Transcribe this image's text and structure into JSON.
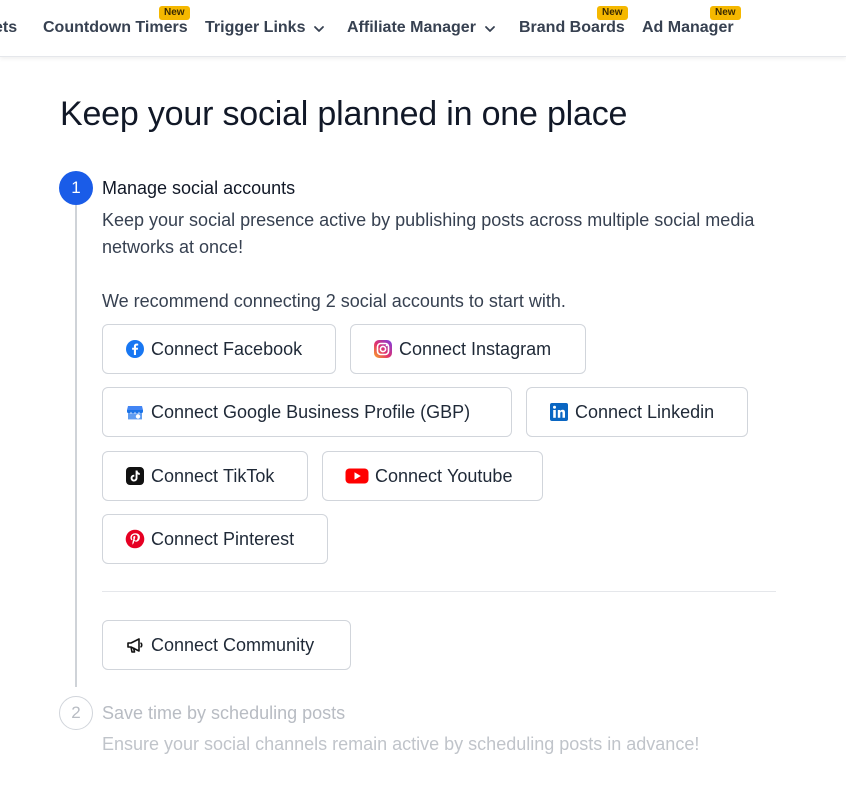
{
  "nav": {
    "items": [
      {
        "label": "ets"
      },
      {
        "label": "Countdown Timers",
        "badge": "New"
      },
      {
        "label": "Trigger Links"
      },
      {
        "label": "Affiliate Manager"
      },
      {
        "label": "Brand Boards",
        "badge": "New"
      },
      {
        "label": "Ad Manager",
        "badge": "New"
      }
    ]
  },
  "page": {
    "title": "Keep your social planned in one place"
  },
  "steps": [
    {
      "number": "1",
      "title": "Manage social accounts",
      "description": "Keep your social presence active by publishing posts across multiple social media networks at once!",
      "recommend": "We recommend connecting 2 social accounts to start with.",
      "connect_word": "Connect",
      "accounts": [
        {
          "name": "Facebook",
          "icon": "facebook-icon"
        },
        {
          "name": "Instagram",
          "icon": "instagram-icon"
        },
        {
          "name": "Google Business Profile (GBP)",
          "icon": "google-business-icon"
        },
        {
          "name": "Linkedin",
          "icon": "linkedin-icon"
        },
        {
          "name": "TikTok",
          "icon": "tiktok-icon"
        },
        {
          "name": "Youtube",
          "icon": "youtube-icon"
        },
        {
          "name": "Pinterest",
          "icon": "pinterest-icon"
        },
        {
          "name": "Community",
          "icon": "megaphone-icon"
        }
      ]
    },
    {
      "number": "2",
      "title": "Save time by scheduling posts",
      "description": "Ensure your social channels remain active by scheduling posts in advance!"
    }
  ],
  "colors": {
    "accent": "#1a5ce8",
    "badge": "#f5b800",
    "facebook": "#1877f2",
    "linkedin": "#0a66c2",
    "youtube": "#ff0000",
    "pinterest": "#e60023"
  }
}
